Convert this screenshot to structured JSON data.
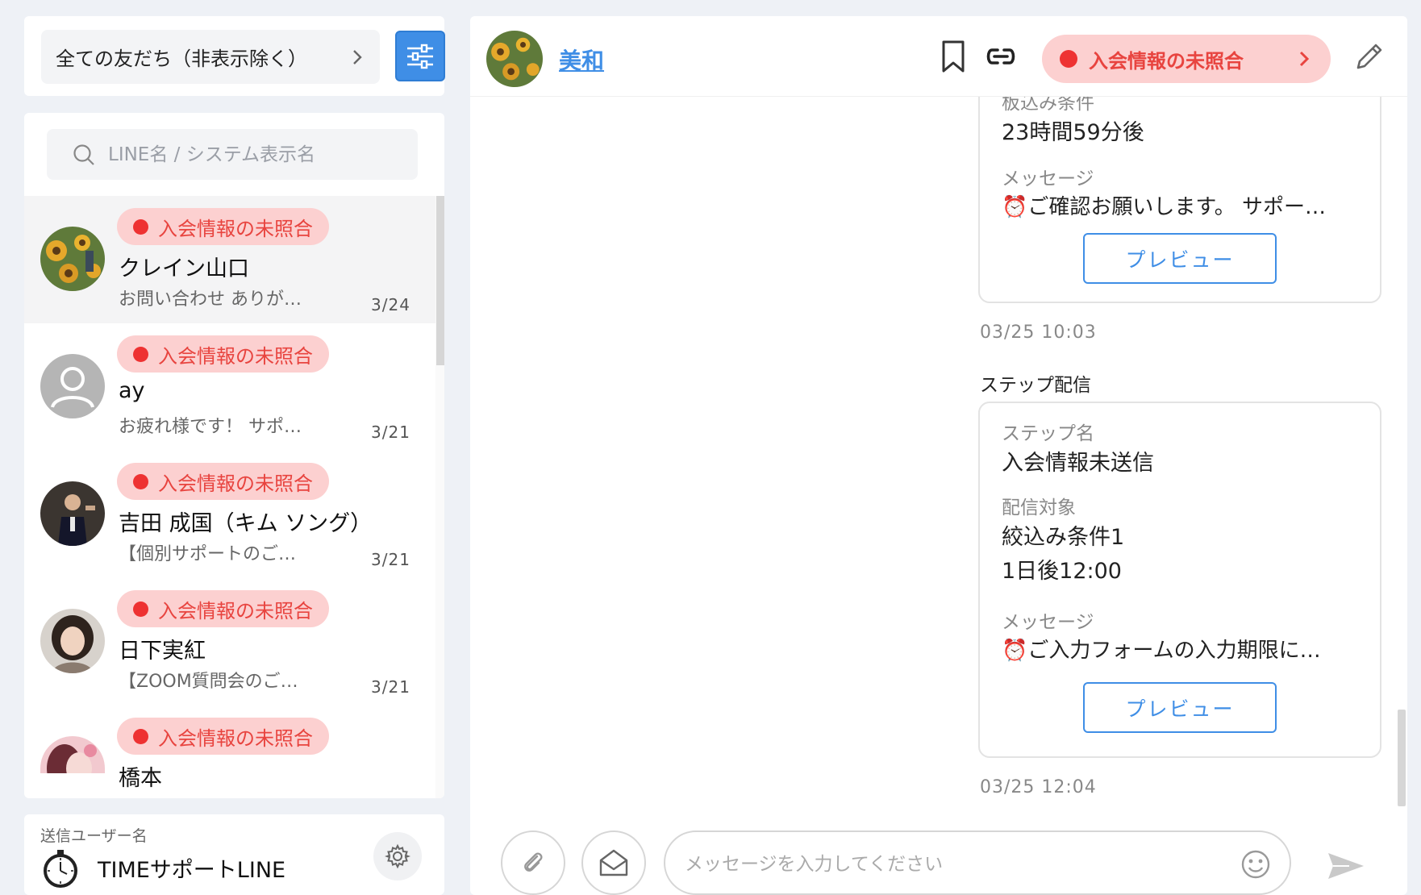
{
  "filter": {
    "label": "全ての友だち（非表示除く）"
  },
  "search": {
    "placeholder": "LINE名 / システム表示名"
  },
  "friends": [
    {
      "badge": "入会情報の未照合",
      "name": "クレイン山口",
      "message": "お問い合わせ ありが…",
      "date": "3/24"
    },
    {
      "badge": "入会情報の未照合",
      "name": "ay",
      "message": "お疲れ様です！ サポ…",
      "date": "3/21"
    },
    {
      "badge": "入会情報の未照合",
      "name": "吉田 成国（キム ソング）",
      "message": "【個別サポートのご…",
      "date": "3/21"
    },
    {
      "badge": "入会情報の未照合",
      "name": "日下実紅",
      "message": "【ZOOM質問会のご…",
      "date": "3/21"
    },
    {
      "badge": "入会情報の未照合",
      "name": "橋本",
      "message": "",
      "date": ""
    }
  ],
  "sender": {
    "label": "送信ユーザー名",
    "name": "TIMEサポートLINE"
  },
  "chat": {
    "user_name": "美和",
    "status": "入会情報の未照合"
  },
  "messages": {
    "card1": {
      "partial_label": "板込み条件",
      "time_value": "23時間59分後",
      "message_label": "メッセージ",
      "message_value": "⏰ご確認お願いします。 サポー…",
      "preview": "プレビュー"
    },
    "ts1": "03/25 10:03",
    "section": "ステップ配信",
    "card2": {
      "step_label": "ステップ名",
      "step_value": "入会情報未送信",
      "target_label": "配信対象",
      "target_value": "絞込み条件1",
      "time_value": "1日後12:00",
      "message_label": "メッセージ",
      "message_value": "⏰ご入力フォームの入力期限に…",
      "preview": "プレビュー"
    },
    "ts2": "03/25 12:04"
  },
  "composer": {
    "placeholder": "メッセージを入力してください"
  },
  "colors": {
    "accent": "#3f8ee6",
    "badge_bg": "#fcd0d0",
    "badge_text": "#e8443f",
    "dot": "#ee3232"
  }
}
